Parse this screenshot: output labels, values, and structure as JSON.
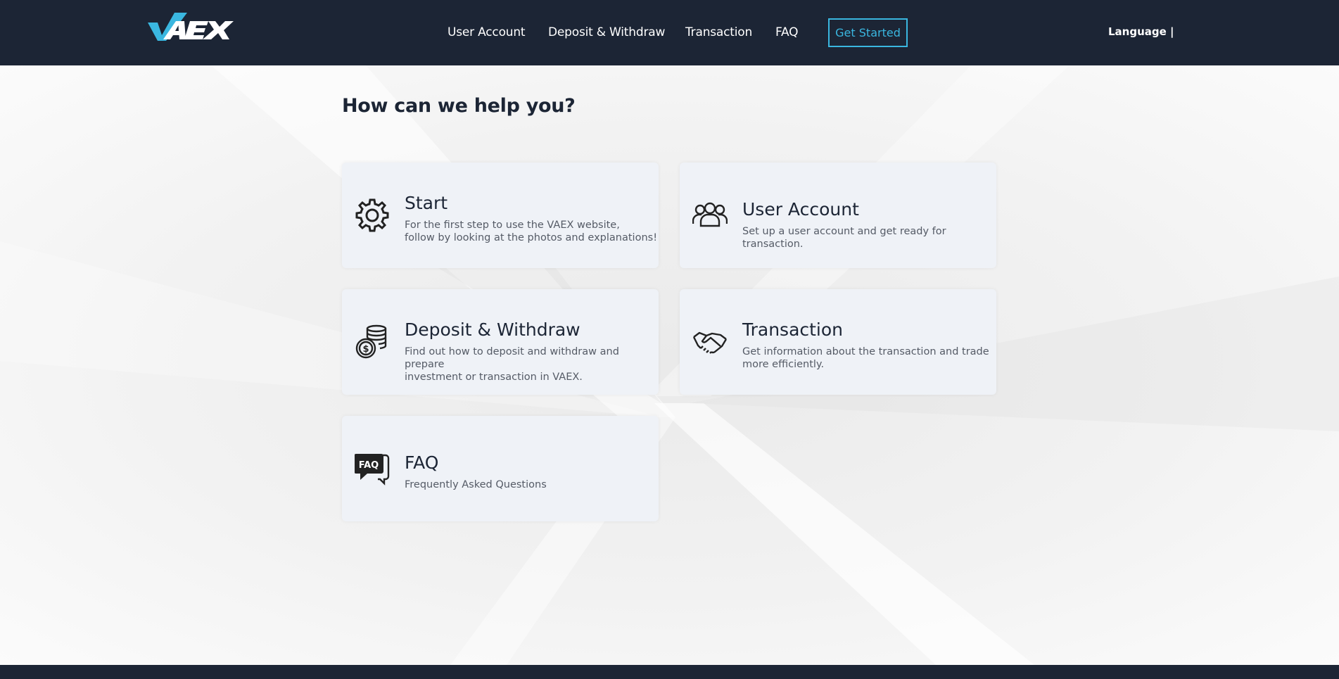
{
  "header": {
    "logo_text": "VAEX",
    "nav": [
      "User Account",
      "Deposit & Withdraw",
      "Transaction",
      "FAQ"
    ],
    "cta_label": "Get Started",
    "language_label": "Language |"
  },
  "main": {
    "headline": "How can we help you?",
    "cards": [
      {
        "icon": "gear-icon",
        "title": "Start",
        "desc_line1": "For the first step to use the VAEX website,",
        "desc_line2": "follow by looking at the photos and explanations!"
      },
      {
        "icon": "users-icon",
        "title": "User Account",
        "desc_line1": "Set up a user account and get ready for transaction.",
        "desc_line2": ""
      },
      {
        "icon": "coins-icon",
        "title": "Deposit & Withdraw",
        "desc_line1": "Find out how to deposit and withdraw and prepare",
        "desc_line2": "investment or transaction in VAEX."
      },
      {
        "icon": "handshake-icon",
        "title": "Transaction",
        "desc_line1": "Get information about the transaction and trade",
        "desc_line2": "more efficiently."
      },
      {
        "icon": "faq-icon",
        "title": "FAQ",
        "desc_line1": "Frequently Asked Questions",
        "desc_line2": ""
      }
    ]
  },
  "colors": {
    "header_bg": "#1c2535",
    "accent": "#3ab7e0",
    "card_bg": "#eff2f7"
  }
}
